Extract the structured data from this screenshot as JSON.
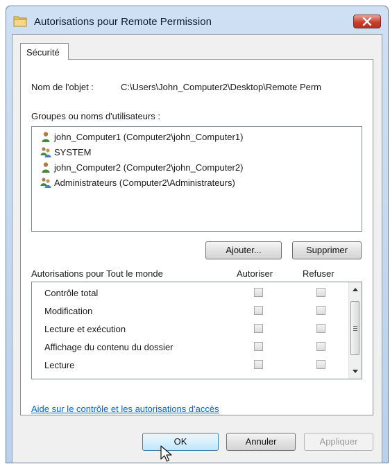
{
  "window": {
    "title": "Autorisations pour Remote Permission"
  },
  "tabs": [
    {
      "label": "Sécurité",
      "active": true
    }
  ],
  "object": {
    "label": "Nom de l'objet :",
    "path": "C:\\Users\\John_Computer2\\Desktop\\Remote Perm"
  },
  "groups": {
    "label": "Groupes ou noms d'utilisateurs :",
    "items": [
      {
        "name": "john_Computer1 (Computer2\\john_Computer1)",
        "icon": "user-icon"
      },
      {
        "name": "SYSTEM",
        "icon": "group-icon"
      },
      {
        "name": "john_Computer2 (Computer2\\john_Computer2)",
        "icon": "user-icon"
      },
      {
        "name": "Administrateurs (Computer2\\Administrateurs)",
        "icon": "group-icon"
      }
    ]
  },
  "buttons": {
    "add": "Ajouter...",
    "remove": "Supprimer",
    "ok": "OK",
    "cancel": "Annuler",
    "apply": "Appliquer"
  },
  "permissions": {
    "label": "Autorisations pour Tout le monde",
    "allow_header": "Autoriser",
    "deny_header": "Refuser",
    "items": [
      {
        "name": "Contrôle total",
        "allow": false,
        "deny": false
      },
      {
        "name": "Modification",
        "allow": false,
        "deny": false
      },
      {
        "name": "Lecture et exécution",
        "allow": false,
        "deny": false
      },
      {
        "name": "Affichage du contenu du dossier",
        "allow": false,
        "deny": false
      },
      {
        "name": "Lecture",
        "allow": false,
        "deny": false
      }
    ]
  },
  "help_link": "Aide sur le contrôle et les autorisations d'accès",
  "colors": {
    "link": "#0066cc",
    "title_gradient": "#cfe0f3",
    "close_button": "#c8402c"
  }
}
